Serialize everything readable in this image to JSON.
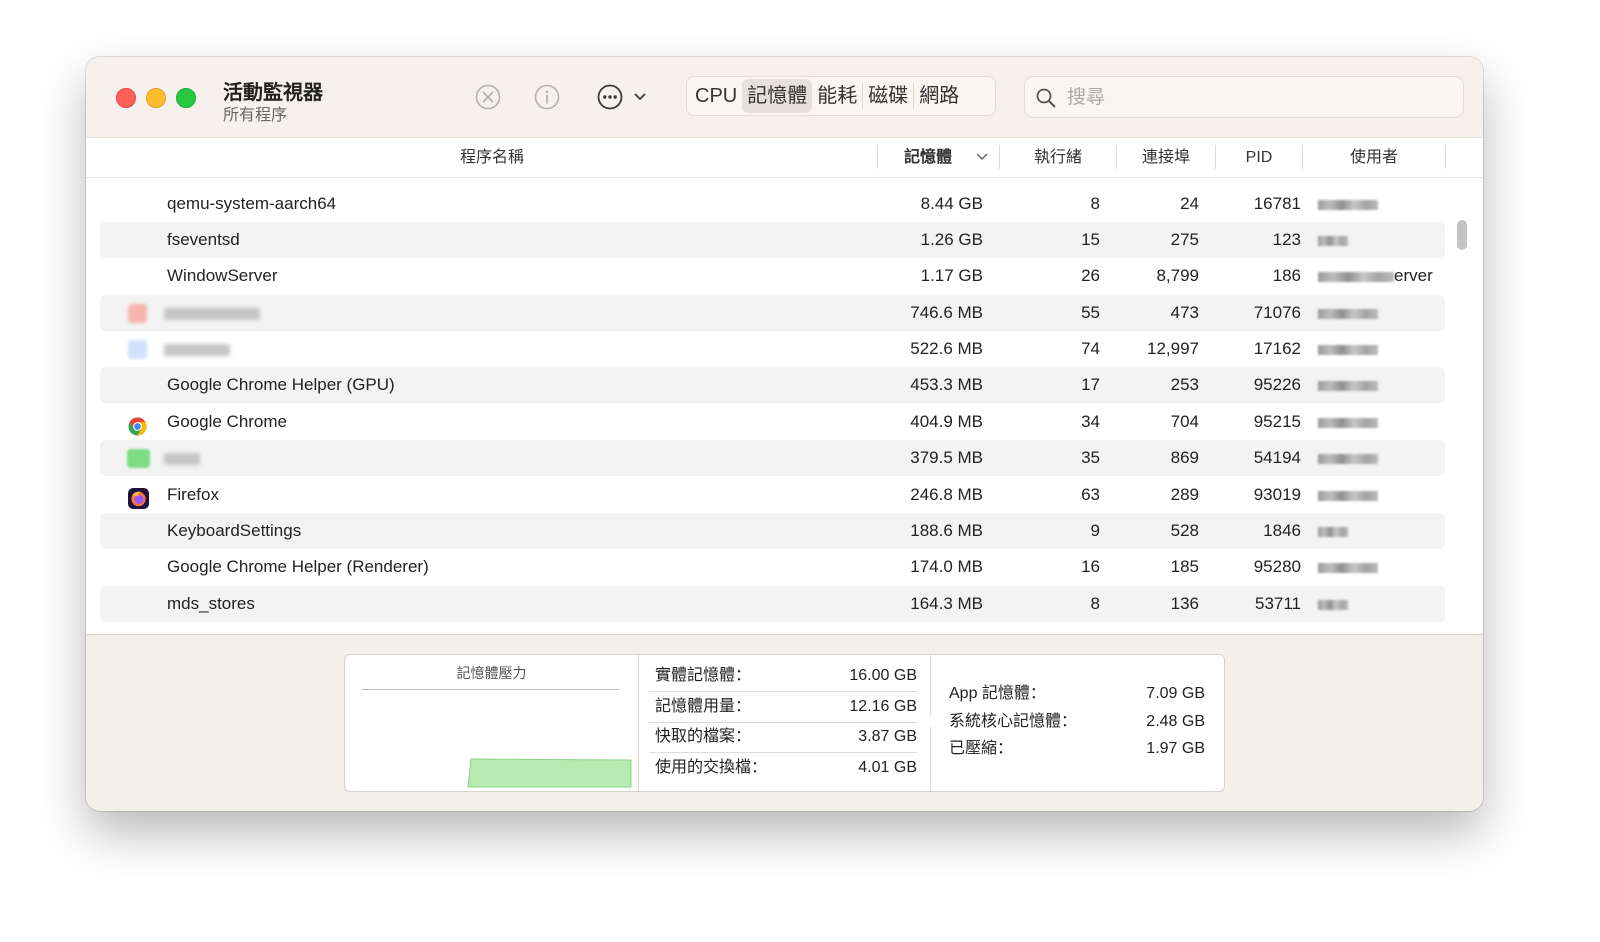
{
  "window": {
    "title": "活動監視器",
    "subtitle": "所有程序"
  },
  "toolbar": {
    "stop_icon": "xmark-circle-icon",
    "info_icon": "info-circle-icon",
    "more_icon": "ellipsis-circle-icon",
    "tabs": [
      {
        "label": "CPU",
        "active": false
      },
      {
        "label": "記憶體",
        "active": true
      },
      {
        "label": "能耗",
        "active": false
      },
      {
        "label": "磁碟",
        "active": false
      },
      {
        "label": "網路",
        "active": false
      }
    ],
    "search_placeholder": "搜尋"
  },
  "table": {
    "columns": {
      "name": "程序名稱",
      "memory": "記憶體",
      "threads": "執行緒",
      "ports": "連接埠",
      "pid": "PID",
      "user": "使用者"
    },
    "sorted_column": "memory",
    "rows": [
      {
        "name": "qemu-system-aarch64",
        "memory": "8.44 GB",
        "threads": "8",
        "ports": "24",
        "pid": "16781",
        "icon": "none",
        "user_suffix": ""
      },
      {
        "name": "fseventsd",
        "memory": "1.26 GB",
        "threads": "15",
        "ports": "275",
        "pid": "123",
        "icon": "none",
        "user_suffix": ""
      },
      {
        "name": "WindowServer",
        "memory": "1.17 GB",
        "threads": "26",
        "ports": "8,799",
        "pid": "186",
        "icon": "none",
        "user_suffix": "erver"
      },
      {
        "name": "",
        "memory": "746.6 MB",
        "threads": "55",
        "ports": "473",
        "pid": "71076",
        "icon": "blurred-app-icon",
        "user_suffix": ""
      },
      {
        "name": "",
        "memory": "522.6 MB",
        "threads": "74",
        "ports": "12,997",
        "pid": "17162",
        "icon": "blurred-app-icon",
        "user_suffix": ""
      },
      {
        "name": "Google Chrome Helper (GPU)",
        "memory": "453.3 MB",
        "threads": "17",
        "ports": "253",
        "pid": "95226",
        "icon": "none",
        "user_suffix": ""
      },
      {
        "name": "Google Chrome",
        "memory": "404.9 MB",
        "threads": "34",
        "ports": "704",
        "pid": "95215",
        "icon": "chrome-icon",
        "user_suffix": ""
      },
      {
        "name": "",
        "memory": "379.5 MB",
        "threads": "35",
        "ports": "869",
        "pid": "54194",
        "icon": "blurred-app-icon",
        "user_suffix": ""
      },
      {
        "name": "Firefox",
        "memory": "246.8 MB",
        "threads": "63",
        "ports": "289",
        "pid": "93019",
        "icon": "firefox-icon",
        "user_suffix": ""
      },
      {
        "name": "KeyboardSettings",
        "memory": "188.6 MB",
        "threads": "9",
        "ports": "528",
        "pid": "1846",
        "icon": "none",
        "user_suffix": ""
      },
      {
        "name": "Google Chrome Helper (Renderer)",
        "memory": "174.0 MB",
        "threads": "16",
        "ports": "185",
        "pid": "95280",
        "icon": "none",
        "user_suffix": ""
      },
      {
        "name": "mds_stores",
        "memory": "164.3 MB",
        "threads": "8",
        "ports": "136",
        "pid": "53711",
        "icon": "none",
        "user_suffix": ""
      }
    ]
  },
  "footer": {
    "pressure_title": "記憶體壓力",
    "pressure_color": "#b6eab0",
    "stats_left": [
      {
        "label": "實體記憶體：",
        "value": "16.00 GB"
      },
      {
        "label": "記憶體用量：",
        "value": "12.16 GB"
      },
      {
        "label": "快取的檔案：",
        "value": "3.87 GB"
      },
      {
        "label": "使用的交換檔：",
        "value": "4.01 GB"
      }
    ],
    "stats_right": [
      {
        "label": "App 記憶體：",
        "value": "7.09 GB"
      },
      {
        "label": "系統核心記憶體：",
        "value": "2.48 GB"
      },
      {
        "label": "已壓縮：",
        "value": "1.97 GB"
      }
    ]
  }
}
